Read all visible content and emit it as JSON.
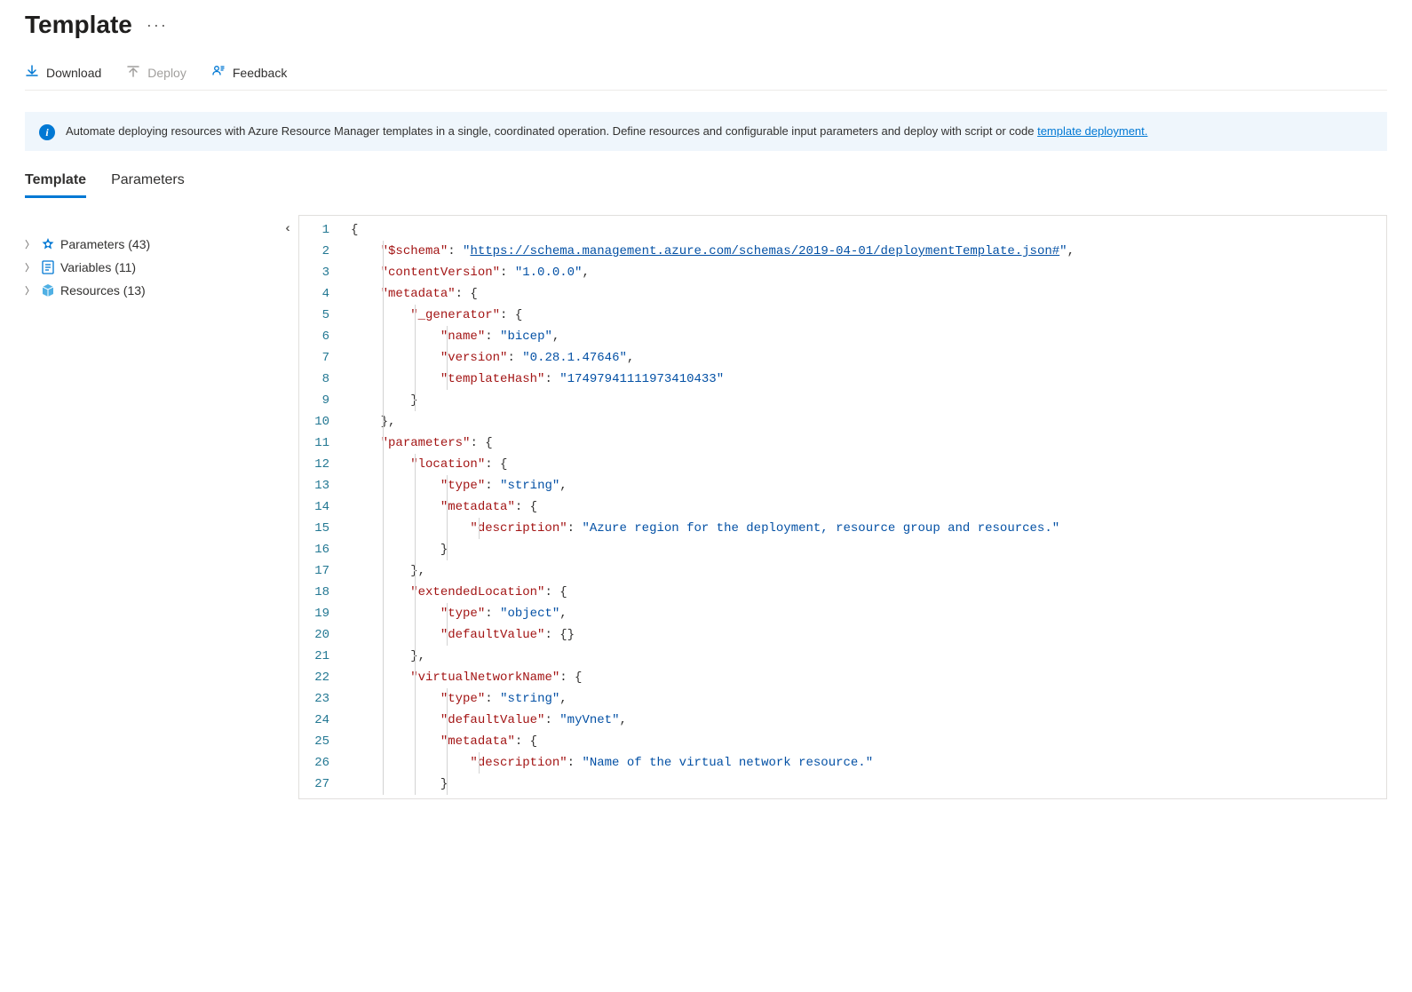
{
  "header": {
    "title": "Template"
  },
  "toolbar": {
    "download_label": "Download",
    "deploy_label": "Deploy",
    "feedback_label": "Feedback"
  },
  "banner": {
    "text_prefix": "Automate deploying resources with Azure Resource Manager templates in a single, coordinated operation. Define resources and configurable input parameters and deploy with script or code ",
    "link_text": "template deployment."
  },
  "tabs": {
    "template": "Template",
    "parameters": "Parameters"
  },
  "tree": {
    "parameters_label": "Parameters (43)",
    "variables_label": "Variables (11)",
    "resources_label": "Resources (13)"
  },
  "editor": {
    "lines": [
      {
        "n": 1,
        "indent": 0,
        "tokens": [
          [
            "{",
            "punc"
          ]
        ]
      },
      {
        "n": 2,
        "indent": 1,
        "tokens": [
          [
            "\"$schema\"",
            "key"
          ],
          [
            ": ",
            "punc"
          ],
          [
            "\"",
            "string"
          ],
          [
            "https://schema.management.azure.com/schemas/2019-04-01/deploymentTemplate.json#",
            "link"
          ],
          [
            "\"",
            "string"
          ],
          [
            ",",
            "punc"
          ]
        ]
      },
      {
        "n": 3,
        "indent": 1,
        "tokens": [
          [
            "\"contentVersion\"",
            "key"
          ],
          [
            ": ",
            "punc"
          ],
          [
            "\"1.0.0.0\"",
            "string"
          ],
          [
            ",",
            "punc"
          ]
        ]
      },
      {
        "n": 4,
        "indent": 1,
        "tokens": [
          [
            "\"metadata\"",
            "key"
          ],
          [
            ": {",
            "punc"
          ]
        ]
      },
      {
        "n": 5,
        "indent": 2,
        "tokens": [
          [
            "\"_generator\"",
            "key"
          ],
          [
            ": {",
            "punc"
          ]
        ]
      },
      {
        "n": 6,
        "indent": 3,
        "tokens": [
          [
            "\"name\"",
            "key"
          ],
          [
            ": ",
            "punc"
          ],
          [
            "\"bicep\"",
            "string"
          ],
          [
            ",",
            "punc"
          ]
        ]
      },
      {
        "n": 7,
        "indent": 3,
        "tokens": [
          [
            "\"version\"",
            "key"
          ],
          [
            ": ",
            "punc"
          ],
          [
            "\"0.28.1.47646\"",
            "string"
          ],
          [
            ",",
            "punc"
          ]
        ]
      },
      {
        "n": 8,
        "indent": 3,
        "tokens": [
          [
            "\"templateHash\"",
            "key"
          ],
          [
            ": ",
            "punc"
          ],
          [
            "\"17497941111973410433\"",
            "string"
          ]
        ]
      },
      {
        "n": 9,
        "indent": 2,
        "tokens": [
          [
            "}",
            "punc"
          ]
        ]
      },
      {
        "n": 10,
        "indent": 1,
        "tokens": [
          [
            "},",
            "punc"
          ]
        ]
      },
      {
        "n": 11,
        "indent": 1,
        "tokens": [
          [
            "\"parameters\"",
            "key"
          ],
          [
            ": {",
            "punc"
          ]
        ]
      },
      {
        "n": 12,
        "indent": 2,
        "tokens": [
          [
            "\"location\"",
            "key"
          ],
          [
            ": {",
            "punc"
          ]
        ]
      },
      {
        "n": 13,
        "indent": 3,
        "tokens": [
          [
            "\"type\"",
            "key"
          ],
          [
            ": ",
            "punc"
          ],
          [
            "\"string\"",
            "string"
          ],
          [
            ",",
            "punc"
          ]
        ]
      },
      {
        "n": 14,
        "indent": 3,
        "tokens": [
          [
            "\"metadata\"",
            "key"
          ],
          [
            ": {",
            "punc"
          ]
        ]
      },
      {
        "n": 15,
        "indent": 4,
        "tokens": [
          [
            "\"description\"",
            "key"
          ],
          [
            ": ",
            "punc"
          ],
          [
            "\"Azure region for the deployment, resource group and resources.\"",
            "string"
          ]
        ]
      },
      {
        "n": 16,
        "indent": 3,
        "tokens": [
          [
            "}",
            "punc"
          ]
        ]
      },
      {
        "n": 17,
        "indent": 2,
        "tokens": [
          [
            "},",
            "punc"
          ]
        ]
      },
      {
        "n": 18,
        "indent": 2,
        "tokens": [
          [
            "\"extendedLocation\"",
            "key"
          ],
          [
            ": {",
            "punc"
          ]
        ]
      },
      {
        "n": 19,
        "indent": 3,
        "tokens": [
          [
            "\"type\"",
            "key"
          ],
          [
            ": ",
            "punc"
          ],
          [
            "\"object\"",
            "string"
          ],
          [
            ",",
            "punc"
          ]
        ]
      },
      {
        "n": 20,
        "indent": 3,
        "tokens": [
          [
            "\"defaultValue\"",
            "key"
          ],
          [
            ": {}",
            "punc"
          ]
        ]
      },
      {
        "n": 21,
        "indent": 2,
        "tokens": [
          [
            "},",
            "punc"
          ]
        ]
      },
      {
        "n": 22,
        "indent": 2,
        "tokens": [
          [
            "\"virtualNetworkName\"",
            "key"
          ],
          [
            ": {",
            "punc"
          ]
        ]
      },
      {
        "n": 23,
        "indent": 3,
        "tokens": [
          [
            "\"type\"",
            "key"
          ],
          [
            ": ",
            "punc"
          ],
          [
            "\"string\"",
            "string"
          ],
          [
            ",",
            "punc"
          ]
        ]
      },
      {
        "n": 24,
        "indent": 3,
        "tokens": [
          [
            "\"defaultValue\"",
            "key"
          ],
          [
            ": ",
            "punc"
          ],
          [
            "\"myVnet\"",
            "string"
          ],
          [
            ",",
            "punc"
          ]
        ]
      },
      {
        "n": 25,
        "indent": 3,
        "tokens": [
          [
            "\"metadata\"",
            "key"
          ],
          [
            ": {",
            "punc"
          ]
        ]
      },
      {
        "n": 26,
        "indent": 4,
        "tokens": [
          [
            "\"description\"",
            "key"
          ],
          [
            ": ",
            "punc"
          ],
          [
            "\"Name of the virtual network resource.\"",
            "string"
          ]
        ]
      },
      {
        "n": 27,
        "indent": 3,
        "tokens": [
          [
            "}",
            "punc"
          ]
        ]
      }
    ]
  }
}
